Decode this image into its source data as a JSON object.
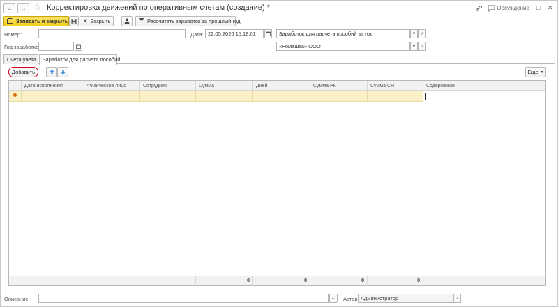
{
  "window": {
    "title": "Корректировка движений по оперативным счетам (создание) *",
    "discussion_label": "Обсуждение",
    "more_glyph": "⋮",
    "minimize_glyph": "□",
    "close_glyph": "✕"
  },
  "toolbar": {
    "save_close_label": "Записать и закрыть",
    "close_label": "Закрыть",
    "calc_label": "Рассчитать заработок за прошлый год"
  },
  "form": {
    "number_label": "Номер:",
    "number_value": "",
    "date_label": "Дата:",
    "date_value": "22.05.2026 15:18:01",
    "operation_value": "Заработок для расчета пособий за год",
    "year_label": "Год заработка:",
    "year_value": "",
    "org_value": "«Ромашка» ООО"
  },
  "tabs": [
    {
      "label": "Счета учета",
      "active": false
    },
    {
      "label": "Заработок для расчета пособий",
      "active": true
    }
  ],
  "table_toolbar": {
    "add_label": "Добавить",
    "more_label": "Еще"
  },
  "table": {
    "columns": [
      "Дата исполнения",
      "Физическое лицо",
      "Сотрудник",
      "Сумма",
      "Дней",
      "Сумма РК",
      "Сумма СН",
      "Содержание"
    ],
    "totals": [
      "0",
      "0",
      "0",
      "0"
    ]
  },
  "footer": {
    "description_label": "Описание:",
    "description_value": "",
    "author_label": "Автор:",
    "author_value": "Администратор"
  },
  "colors": {
    "primary_button": "#f2cf1d",
    "selected_row": "#fbefc6",
    "add_button_ring": "#d0021b",
    "arrow_blue": "#3d8fd8"
  }
}
